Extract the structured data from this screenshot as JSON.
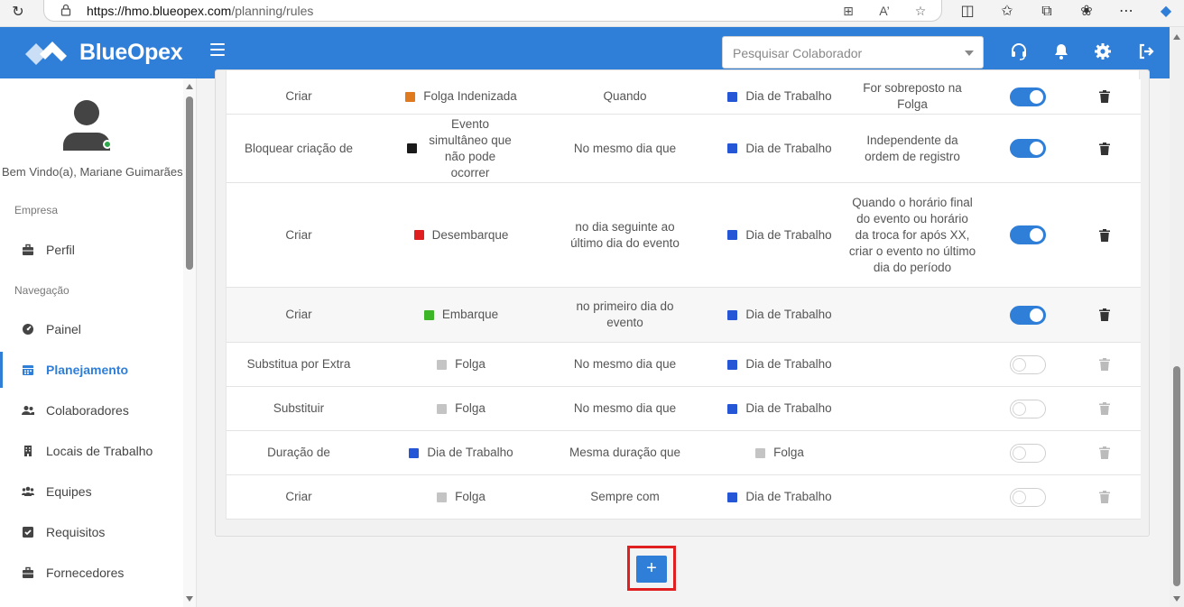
{
  "browser": {
    "url_host": "https://hmo.blueopex.com",
    "url_path": "/planning/rules"
  },
  "header": {
    "brand": "BlueOpex",
    "search_placeholder": "Pesquisar Colaborador",
    "accent_color": "#2f7ed8"
  },
  "sidebar": {
    "welcome": "Bem Vindo(a), Mariane Guimarães",
    "section_company": "Empresa",
    "section_nav": "Navegação",
    "items": [
      {
        "label": "Perfil",
        "icon": "briefcase-icon"
      },
      {
        "label": "Painel",
        "icon": "dashboard-icon"
      },
      {
        "label": "Planejamento",
        "icon": "calendar-icon",
        "active": true
      },
      {
        "label": "Colaboradores",
        "icon": "users-icon"
      },
      {
        "label": "Locais de Trabalho",
        "icon": "building-icon"
      },
      {
        "label": "Equipes",
        "icon": "team-icon"
      },
      {
        "label": "Requisitos",
        "icon": "checkbox-icon"
      },
      {
        "label": "Fornecedores",
        "icon": "briefcase-icon"
      }
    ]
  },
  "rules": [
    {
      "action": "Criar",
      "event1": "Folga Indenizada",
      "event1_color": "#e07a1f",
      "condition": "Quando",
      "event2": "Dia de Trabalho",
      "event2_color": "#2456d6",
      "extra": "For sobreposto na Folga",
      "enabled": true
    },
    {
      "action": "Bloquear criação de",
      "event1": "Evento simultâneo que não pode ocorrer",
      "event1_color": "#1a1a1a",
      "condition": "No mesmo dia que",
      "event2": "Dia de Trabalho",
      "event2_color": "#2456d6",
      "extra": "Independente da ordem de registro",
      "enabled": true
    },
    {
      "action": "Criar",
      "event1": "Desembarque",
      "event1_color": "#e02020",
      "condition": "no dia seguinte ao último dia do evento",
      "event2": "Dia de Trabalho",
      "event2_color": "#2456d6",
      "extra": "Quando o horário final do evento ou horário da troca for após XX, criar o evento no último dia do período",
      "enabled": true
    },
    {
      "action": "Criar",
      "event1": "Embarque",
      "event1_color": "#3cb526",
      "condition": "no primeiro dia do evento",
      "event2": "Dia de Trabalho",
      "event2_color": "#2456d6",
      "extra": "",
      "enabled": true
    },
    {
      "action": "Substitua por Extra",
      "event1": "Folga",
      "event1_color": "#c4c4c4",
      "condition": "No mesmo dia que",
      "event2": "Dia de Trabalho",
      "event2_color": "#2456d6",
      "extra": "",
      "enabled": false
    },
    {
      "action": "Substituir",
      "event1": "Folga",
      "event1_color": "#c4c4c4",
      "condition": "No mesmo dia que",
      "event2": "Dia de Trabalho",
      "event2_color": "#2456d6",
      "extra": "",
      "enabled": false
    },
    {
      "action": "Duração de",
      "event1": "Dia de Trabalho",
      "event1_color": "#2456d6",
      "condition": "Mesma duração que",
      "event2": "Folga",
      "event2_color": "#c4c4c4",
      "extra": "",
      "enabled": false
    },
    {
      "action": "Criar",
      "event1": "Folga",
      "event1_color": "#c4c4c4",
      "condition": "Sempre com",
      "event2": "Dia de Trabalho",
      "event2_color": "#2456d6",
      "extra": "",
      "enabled": false
    }
  ],
  "add_button_label": "+"
}
